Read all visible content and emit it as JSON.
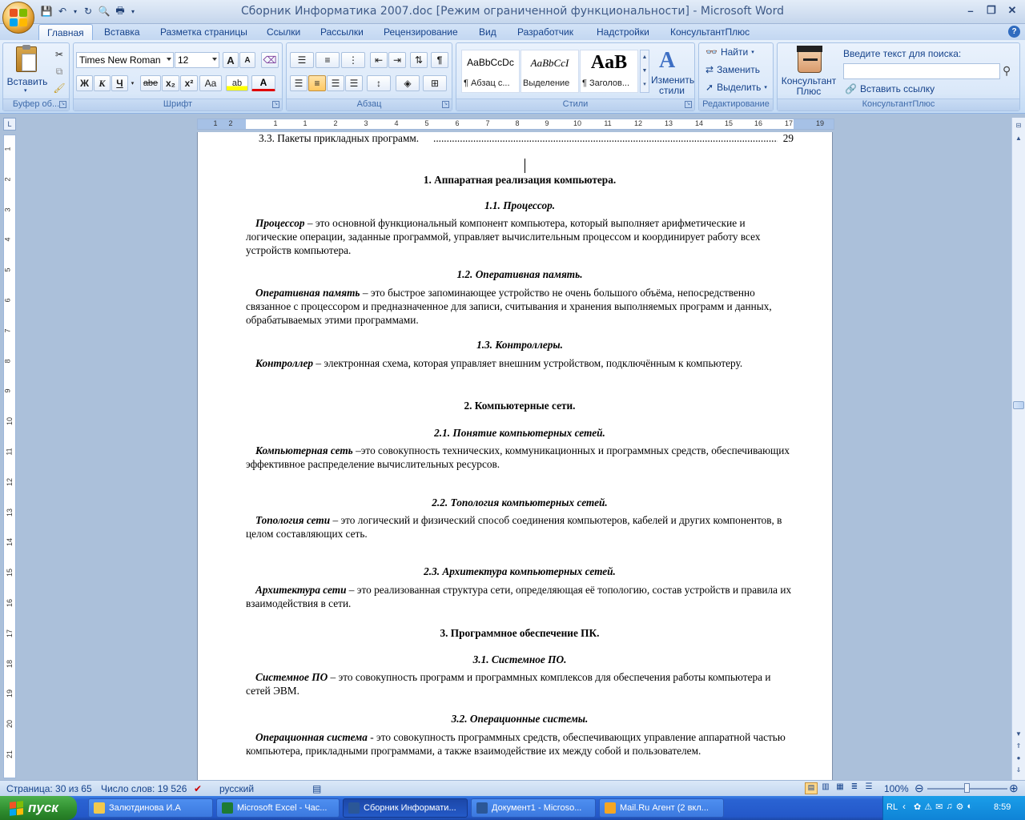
{
  "window": {
    "title": "Сборник Информатика 2007.doc [Режим ограниченной функциональности] - Microsoft Word"
  },
  "tabs": [
    {
      "label": "Главная",
      "active": true
    },
    {
      "label": "Вставка"
    },
    {
      "label": "Разметка страницы"
    },
    {
      "label": "Ссылки"
    },
    {
      "label": "Рассылки"
    },
    {
      "label": "Рецензирование"
    },
    {
      "label": "Вид"
    },
    {
      "label": "Разработчик"
    },
    {
      "label": "Надстройки"
    },
    {
      "label": "КонсультантПлюс"
    }
  ],
  "ribbon": {
    "clipboard": {
      "label": "Буфер об...",
      "paste_label": "Вставить"
    },
    "font": {
      "label": "Шрифт",
      "font_name": "Times New Roman",
      "font_size": "12",
      "grow": "A",
      "shrink": "A",
      "bold": "Ж",
      "italic": "К",
      "underline": "Ч",
      "strike": "abe",
      "subscript": "x₂",
      "superscript": "x²",
      "case": "Aa",
      "highlight": "ab",
      "font_color": "A"
    },
    "paragraph": {
      "label": "Абзац",
      "show_marks": "¶"
    },
    "styles": {
      "label": "Стили",
      "items": [
        {
          "sample": "AaBbCcDc",
          "name": "¶ Абзац с..."
        },
        {
          "sample": "AaBbCcI",
          "name": "Выделение"
        },
        {
          "sample": "AaB",
          "name": "¶ Заголов..."
        }
      ],
      "change_label_1": "Изменить",
      "change_label_2": "стили"
    },
    "editing": {
      "label": "Редактирование",
      "find": "Найти",
      "replace": "Заменить",
      "select": "Выделить"
    },
    "consultant": {
      "label": "КонсультантПлюс",
      "btn_line1": "Консультант",
      "btn_line2": "Плюс",
      "search_label": "Введите текст для поиска:",
      "search_value": "",
      "insert_link": "Вставить ссылку"
    }
  },
  "document": {
    "toc_line": {
      "text": "3.3. Пакеты прикладных программ.",
      "dots": "..............................................................................................................................................",
      "page": "29"
    },
    "sections": [
      {
        "kind": "h1",
        "text": "1. Аппаратная реализация компьютера."
      },
      {
        "kind": "h2",
        "text": "1.1. Процессор."
      },
      {
        "kind": "p",
        "term": "Процессор",
        "text": " – это основной функциональный компонент компьютера, который выполняет арифметические и логические операции, заданные программой, управляет вычислительным процессом и координирует работу всех устройств компьютера."
      },
      {
        "kind": "h2",
        "text": "1.2. Оперативная память."
      },
      {
        "kind": "p",
        "term": "Оперативная память",
        "text": " – это быстрое запоминающее устройство не очень большого объёма, непосредственно связанное с процессором и предназначенное для записи, считывания и хранения выполняемых программ и данных, обрабатываемых этими программами."
      },
      {
        "kind": "h2",
        "text": "1.3. Контроллеры."
      },
      {
        "kind": "p",
        "term": "Контроллер",
        "text": " – электронная схема, которая управляет внешним устройством, подключённым к компьютеру."
      },
      {
        "kind": "h1",
        "text": "2. Компьютерные сети."
      },
      {
        "kind": "h2",
        "text": "2.1. Понятие компьютерных сетей."
      },
      {
        "kind": "p",
        "term": "Компьютерная сеть",
        "text": " –это совокупность технических, коммуникационных и программных средств, обеспечивающих эффективное распределение вычислительных ресурсов."
      },
      {
        "kind": "h2",
        "text": "2.2. Топология компьютерных сетей."
      },
      {
        "kind": "p",
        "term": "Топология сети",
        "text": " – это логический и физический способ соединения компьютеров, кабелей и других компонентов, в целом составляющих сеть."
      },
      {
        "kind": "h2",
        "text": "2.3. Архитектура компьютерных сетей."
      },
      {
        "kind": "p",
        "term": "Архитектура сети",
        "text": " – это реализованная структура сети, определяющая её топологию, состав устройств и правила их взаимодействия в сети."
      },
      {
        "kind": "h1",
        "text": "3. Программное обеспечение ПК."
      },
      {
        "kind": "h2",
        "text": "3.1. Системное ПО."
      },
      {
        "kind": "p",
        "term": "Системное ПО",
        "text": " – это совокупность программ и программных комплексов для обеспечения работы компьютера и сетей ЭВМ."
      },
      {
        "kind": "h2",
        "text": "3.2. Операционные системы."
      },
      {
        "kind": "p",
        "term": "Операционная система",
        "text": " - это совокупность программных средств, обеспечивающих управление аппаратной частью компьютера, прикладными программами, а также взаимодействие их между собой и пользователем."
      }
    ]
  },
  "ruler": {
    "h_numbers": [
      "1",
      "2",
      "1",
      "1",
      "2",
      "3",
      "4",
      "5",
      "6",
      "7",
      "8",
      "9",
      "10",
      "11",
      "12",
      "13",
      "14",
      "15",
      "16",
      "17",
      "19"
    ],
    "v_numbers": [
      "1",
      "2",
      "3",
      "4",
      "5",
      "6",
      "7",
      "8",
      "9",
      "10",
      "11",
      "12",
      "13",
      "14",
      "15",
      "16",
      "17",
      "18",
      "19",
      "20",
      "21"
    ]
  },
  "statusbar": {
    "page": "Страница: 30 из 65",
    "words": "Число слов: 19 526",
    "language": "русский",
    "zoom": "100%"
  },
  "taskbar": {
    "start": "пуск",
    "tasks": [
      {
        "label": "Залютдинова И.А",
        "color": "#f2c94c"
      },
      {
        "label": "Microsoft Excel - Час...",
        "color": "#1e7b34"
      },
      {
        "label": "Сборник Информати...",
        "color": "#2b5797",
        "active": true
      },
      {
        "label": "Документ1 - Microso...",
        "color": "#2b5797"
      },
      {
        "label": "Mail.Ru Агент (2 вкл...",
        "color": "#f5a623"
      }
    ],
    "lang": "RL",
    "clock": "8:59"
  }
}
